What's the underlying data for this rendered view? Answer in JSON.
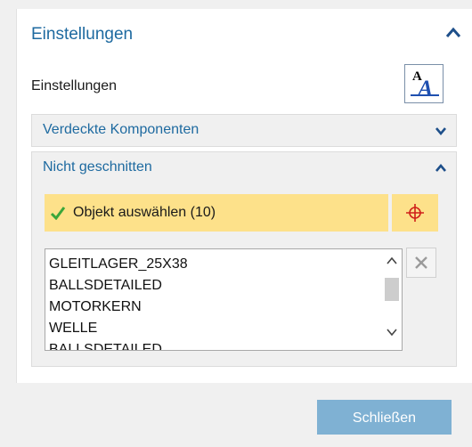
{
  "panel": {
    "header_title": "Einstellungen",
    "settings_label": "Einstellungen",
    "text_style_button": {
      "char_big": "A",
      "char_small": "A"
    }
  },
  "sections": {
    "hidden_components": {
      "title": "Verdeckte Komponenten",
      "expanded": false
    },
    "not_sectioned": {
      "title": "Nicht geschnitten",
      "expanded": true,
      "select_label": "Objekt auswählen (10)",
      "list_items": [
        "GLEITLAGER_25X38",
        "BALLSDETAILED",
        "MOTORKERN",
        "WELLE",
        "BALLSDETAILED"
      ]
    }
  },
  "footer": {
    "close_label": "Schließen"
  },
  "colors": {
    "accent_blue": "#1e6aa0",
    "select_bar": "#fde18a",
    "close_button": "#7fb1d3",
    "check_green": "#3aa63a",
    "target_red": "#d0201a"
  }
}
